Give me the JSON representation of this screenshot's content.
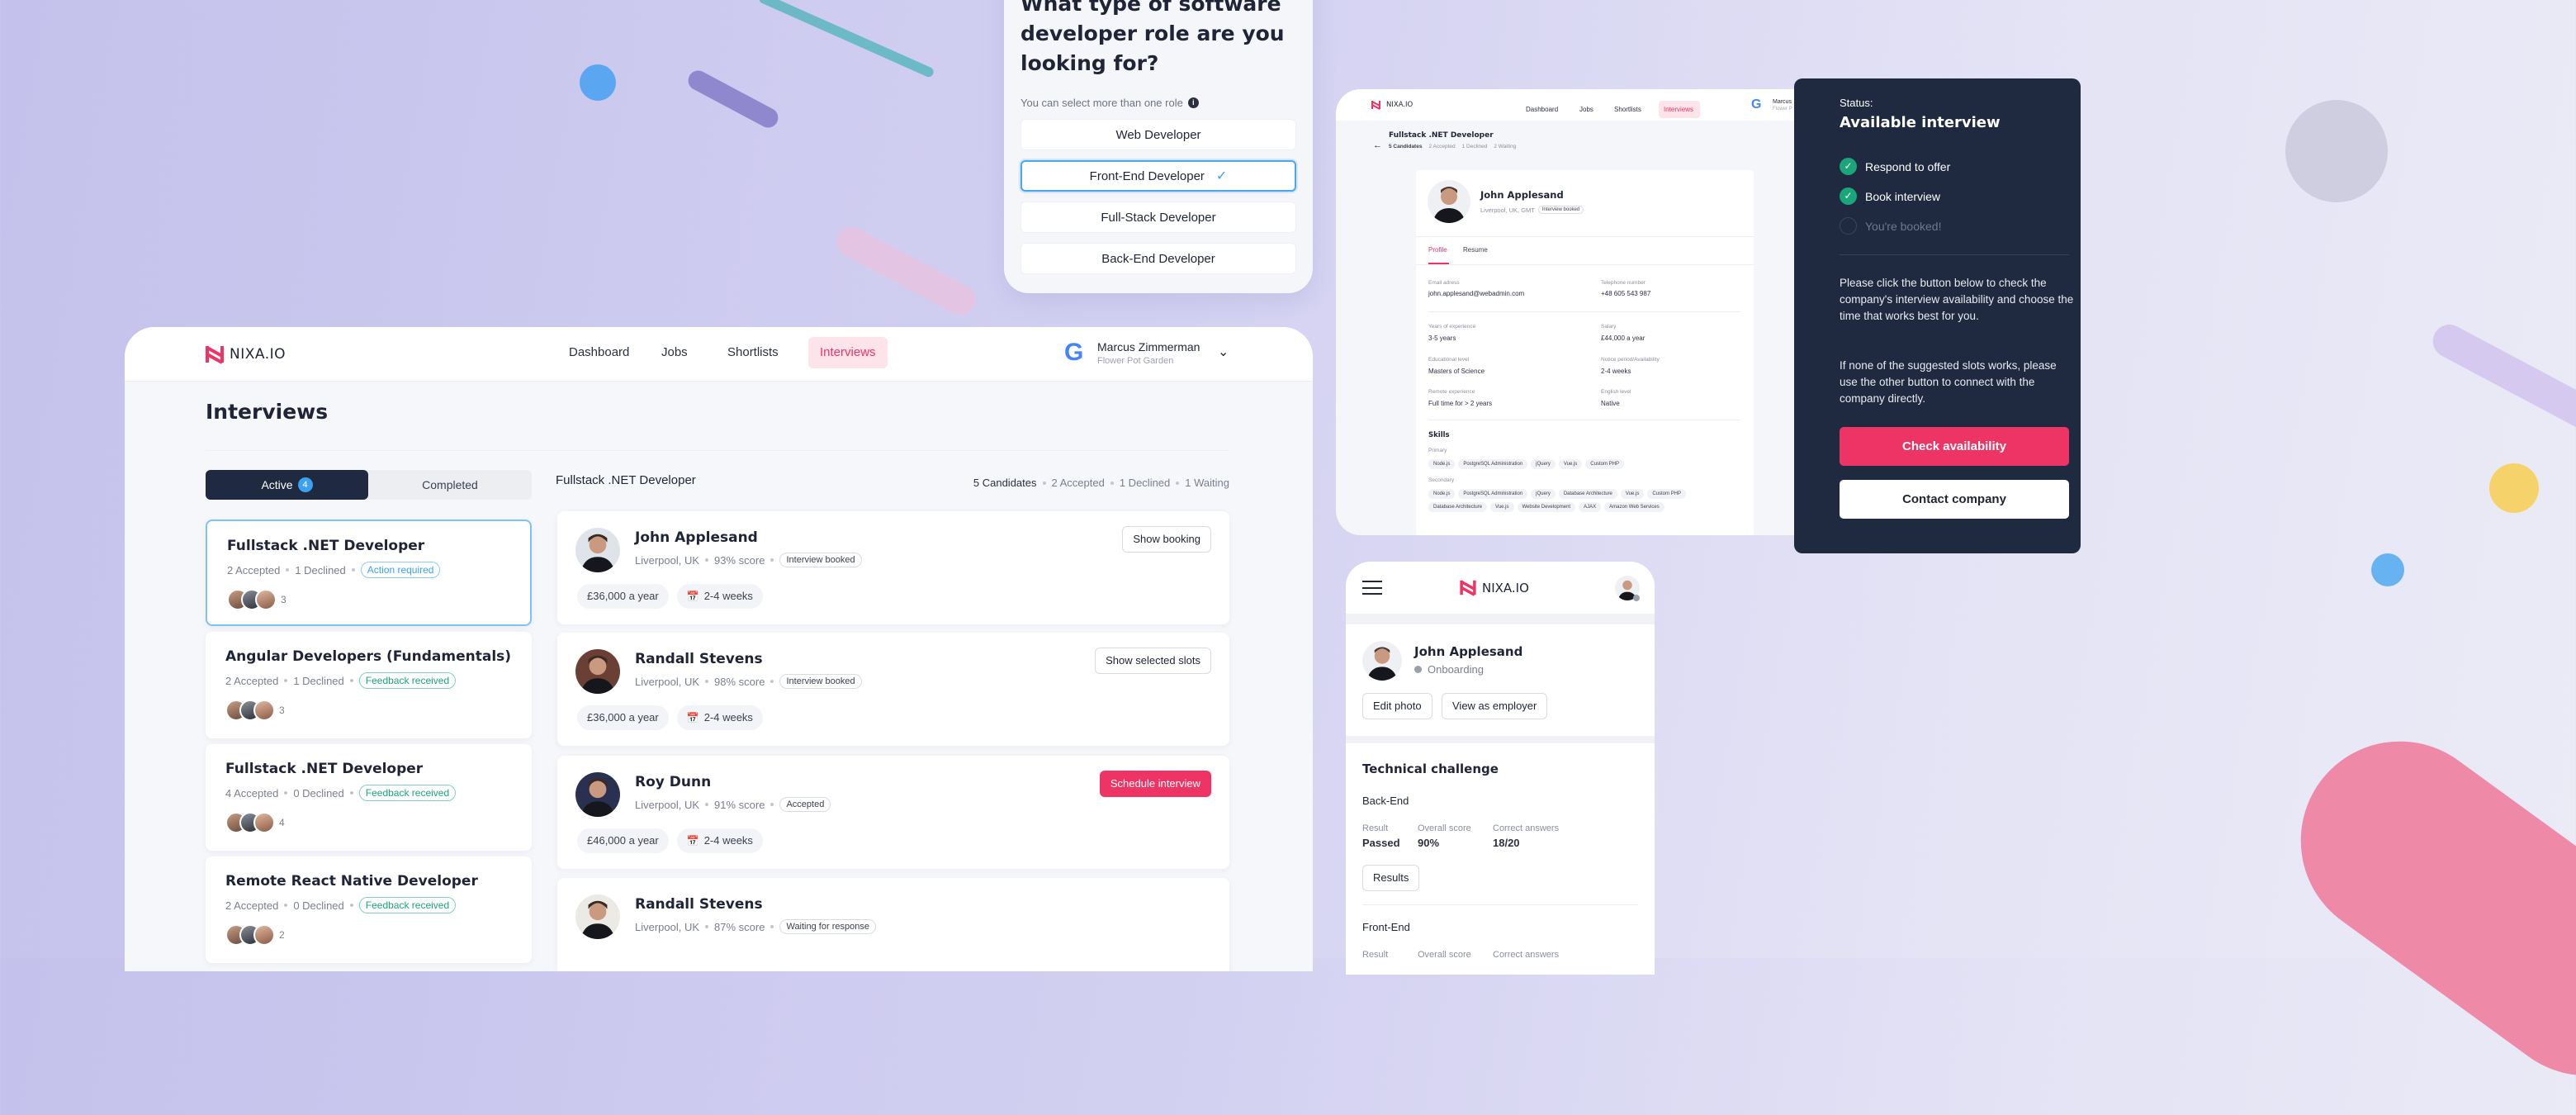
{
  "colors": {
    "accent": "#ee3465",
    "navy": "#1f2a40",
    "blue": "#3ba1f0",
    "green": "#1aa67a"
  },
  "brand": "NIXA.IO",
  "question": {
    "title": "What type of software developer role are you looking for?",
    "hint": "You can select more than one role",
    "options": [
      {
        "label": "Web Developer",
        "selected": false
      },
      {
        "label": "Front-End Developer",
        "selected": true
      },
      {
        "label": "Full-Stack Developer",
        "selected": false
      },
      {
        "label": "Back-End Developer",
        "selected": false
      }
    ]
  },
  "nav": {
    "items": [
      "Dashboard",
      "Jobs",
      "Shortlists",
      "Interviews"
    ],
    "active": "Interviews",
    "user_name": "Marcus Zimmerman",
    "user_company": "Flower Pot Garden"
  },
  "main": {
    "title": "Interviews",
    "tabs": {
      "active": "Active",
      "active_count": "4",
      "completed": "Completed"
    },
    "selected_job": "Fullstack .NET Developer",
    "stats": {
      "candidates": "5 Candidates",
      "accepted": "2 Accepted",
      "declined": "1 Declined",
      "waiting": "1 Waiting"
    },
    "jobs": [
      {
        "title": "Fullstack .NET Developer",
        "accepted": "2 Accepted",
        "declined": "1 Declined",
        "badge": "Action required",
        "badge_type": "action",
        "count": "3"
      },
      {
        "title": "Angular Developers (Fundamentals)",
        "accepted": "2 Accepted",
        "declined": "1 Declined",
        "badge": "Feedback received",
        "badge_type": "feedback",
        "count": "3"
      },
      {
        "title": "Fullstack .NET Developer",
        "accepted": "4 Accepted",
        "declined": "0 Declined",
        "badge": "Feedback received",
        "badge_type": "feedback",
        "count": "4"
      },
      {
        "title": "Remote React Native Developer",
        "accepted": "2 Accepted",
        "declined": "0 Declined",
        "badge": "Feedback received",
        "badge_type": "feedback",
        "count": "2"
      }
    ],
    "candidates": [
      {
        "name": "John Applesand",
        "location": "Liverpool, UK",
        "score": "93% score",
        "status": "Interview booked",
        "button": "Show booking",
        "primary": false,
        "salary": "£36,000 a year",
        "notice": "2-4 weeks"
      },
      {
        "name": "Randall Stevens",
        "location": "Liverpool, UK",
        "score": "98% score",
        "status": "Interview booked",
        "button": "Show selected slots",
        "primary": false,
        "salary": "£36,000 a year",
        "notice": "2-4 weeks"
      },
      {
        "name": "Roy Dunn",
        "location": "Liverpool, UK",
        "score": "91% score",
        "status": "Accepted",
        "button": "Schedule interview",
        "primary": true,
        "salary": "£46,000 a year",
        "notice": "2-4 weeks"
      },
      {
        "name": "Randall Stevens",
        "location": "Liverpool, UK",
        "score": "87% score",
        "status": "Waiting for response",
        "button": "",
        "primary": false,
        "salary": "",
        "notice": ""
      }
    ]
  },
  "profile": {
    "job": "Fullstack .NET Developer",
    "stats": {
      "candidates": "5 Candidates",
      "accepted": "2 Accepted",
      "declined": "1 Declined",
      "waiting": "2 Waiting"
    },
    "user_short": "Marcus",
    "user_company_short": "Flower P",
    "name": "John Applesand",
    "location": "Liverpool, UK, GMT",
    "status": "Interview booked",
    "tabs": [
      "Profile",
      "Resume"
    ],
    "fields": {
      "email_label": "Email adress",
      "email": "john.applesand@webadmin.com",
      "phone_label": "Telephone number",
      "phone": "+48 605 543 987",
      "years_label": "Years of experience",
      "years": "3-5 years",
      "salary_label": "Salary",
      "salary": "£44,000 a year",
      "edu_label": "Educational level",
      "edu": "Masters of Science",
      "notice_label": "Notice period/Availability",
      "notice": "2-4 weeks",
      "remote_label": "Remote experience",
      "remote": "Full time for > 2 years",
      "english_label": "English level",
      "english": "Native"
    },
    "skills_title": "Skills",
    "primary_label": "Primary",
    "primary": [
      "Node.js",
      "PostgreSQL Administration",
      "jQuery",
      "Vue.js",
      "Custom PHP"
    ],
    "secondary_label": "Secondary",
    "secondary": [
      "Node.js",
      "PostgreSQL Administration",
      "jQuery",
      "Database Architecture",
      "Vue.js",
      "Custom PHP",
      "Database Architecture",
      "Vue.js",
      "Website Development",
      "AJAX",
      "Amazon Web Services"
    ]
  },
  "status_panel": {
    "label": "Status:",
    "title": "Available interview",
    "steps": [
      {
        "label": "Respond to offer",
        "done": true
      },
      {
        "label": "Book interview",
        "done": true
      },
      {
        "label": "You're booked!",
        "done": false
      }
    ],
    "para1": "Please click the button below to check the company's interview availability and choose the time that works best for you.",
    "para2": "If none of the suggested slots works, please use the other button to connect with the company directly.",
    "primary_button": "Check availability",
    "secondary_button": "Contact company"
  },
  "mobile": {
    "name": "John Applesand",
    "status": "Onboarding",
    "edit_photo": "Edit photo",
    "view_as_employer": "View as employer",
    "section_title": "Technical challenge",
    "backend": {
      "title": "Back-End",
      "result_label": "Result",
      "result": "Passed",
      "score_label": "Overall score",
      "score": "90%",
      "answers_label": "Correct answers",
      "answers": "18/20",
      "button": "Results"
    },
    "frontend": {
      "title": "Front-End",
      "result_label": "Result",
      "score_label": "Overall score",
      "answers_label": "Correct answers"
    }
  }
}
